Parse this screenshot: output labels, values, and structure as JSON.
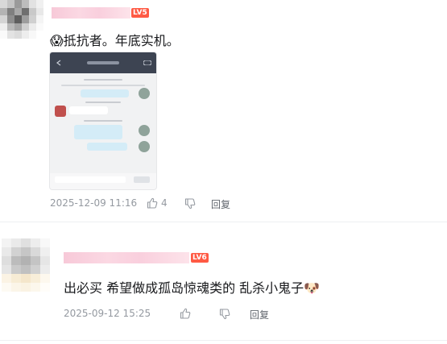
{
  "comments": [
    {
      "username_level": "LV5",
      "emoji": "😱",
      "text": "抵抗者。年底实机。",
      "time": "2025-12-09 11:16",
      "like_count": "4",
      "reply_label": "回复",
      "has_image": true
    },
    {
      "username_level": "LV6",
      "text": "出必买 希望做成孤岛惊魂类的 乱杀小鬼子",
      "emoji": "🐶",
      "time": "2025-09-12 15:25",
      "reply_label": "回复"
    }
  ],
  "icons": {
    "like": "thumbs-up-icon",
    "dislike": "thumbs-down-icon"
  },
  "colors": {
    "text": "#18191c",
    "meta": "#9499a0",
    "level_badge": "#ff5a44",
    "username_blur": "#f7c9d8"
  }
}
